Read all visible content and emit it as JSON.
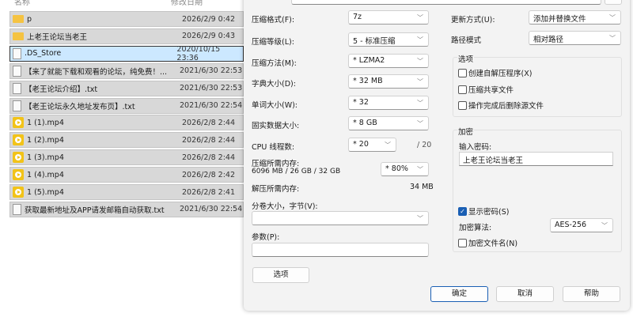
{
  "explorer": {
    "headers": {
      "name": "名称",
      "date": "修改日期"
    },
    "files": [
      {
        "name": "p",
        "date": "2026/2/9 0:42",
        "type": "folder"
      },
      {
        "name": "上老王论坛当老王",
        "date": "2026/2/9 0:43",
        "type": "folder"
      },
      {
        "name": ".DS_Store",
        "date": "2020/10/15 23:36",
        "type": "file",
        "selected": true
      },
      {
        "name": "【来了就能下载和观看的论坛，纯免费！...",
        "date": "2021/6/30 22:53",
        "type": "text"
      },
      {
        "name": "【老王论坛介绍】.txt",
        "date": "2021/6/30 22:53",
        "type": "text"
      },
      {
        "name": "【老王论坛永久地址发布页】.txt",
        "date": "2021/6/30 22:54",
        "type": "text"
      },
      {
        "name": "1 (1).mp4",
        "date": "2026/2/8 2:44",
        "type": "video"
      },
      {
        "name": "1 (2).mp4",
        "date": "2026/2/8 2:44",
        "type": "video"
      },
      {
        "name": "1 (3).mp4",
        "date": "2026/2/8 2:44",
        "type": "video"
      },
      {
        "name": "1 (4).mp4",
        "date": "2026/2/8 2:42",
        "type": "video"
      },
      {
        "name": "1 (5).mp4",
        "date": "2026/2/8 2:41",
        "type": "video"
      },
      {
        "name": "获取最新地址及APP请发邮箱自动获取.txt",
        "date": "2021/6/30 22:54",
        "type": "text"
      }
    ]
  },
  "dialog": {
    "format": {
      "label": "压缩格式(F):",
      "value": "7z"
    },
    "level": {
      "label": "压缩等级(L):",
      "value": "5 - 标准压缩"
    },
    "method": {
      "label": "压缩方法(M):",
      "value": "* LZMA2"
    },
    "dict": {
      "label": "字典大小(D):",
      "value": "* 32 MB"
    },
    "word": {
      "label": "单词大小(W):",
      "value": "* 32"
    },
    "solid": {
      "label": "固实数据大小:",
      "value": "* 8 GB"
    },
    "cpu": {
      "label": "CPU 线程数:",
      "value": "* 20",
      "max": "/ 20"
    },
    "mem": {
      "label": "压缩所需内存:",
      "detail": "6096 MB / 26 GB / 32 GB",
      "value": "* 80%"
    },
    "decomp": {
      "label": "解压所需内存:",
      "value": "34 MB"
    },
    "volume": {
      "label": "分卷大小，字节(V):",
      "value": ""
    },
    "params": {
      "label": "参数(P):",
      "value": ""
    },
    "options_button": "选项",
    "update": {
      "label": "更新方式(U):",
      "value": "添加并替换文件"
    },
    "path": {
      "label": "路径模式",
      "value": "相对路径"
    },
    "options_group": {
      "title": "选项",
      "sfx": "创建自解压程序(X)",
      "shared": "压缩共享文件",
      "delete": "操作完成后删除源文件"
    },
    "encryption": {
      "title": "加密",
      "password_label": "输入密码:",
      "password": "上老王论坛当老王",
      "show_password": "显示密码(S)",
      "method_label": "加密算法:",
      "method": "AES-256",
      "encrypt_names": "加密文件名(N)"
    },
    "ok": "确定",
    "cancel": "取消",
    "help": "帮助"
  }
}
